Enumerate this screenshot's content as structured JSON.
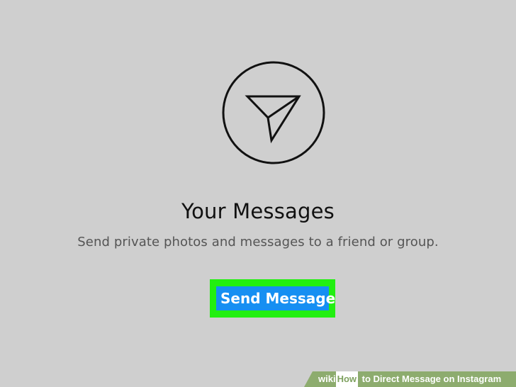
{
  "header": {
    "icon": "paper-plane-icon"
  },
  "main": {
    "title": "Your Messages",
    "subtitle": "Send private photos and messages to a friend or group.",
    "button_label": "Send Message"
  },
  "footer": {
    "brand_wiki": "wiki",
    "brand_how": "How",
    "title_rest": " to Direct Message on Instagram"
  },
  "colors": {
    "background": "#cfcfcf",
    "button": "#168ff2",
    "button_highlight": "#22ef11",
    "banner": "#8dac6e"
  }
}
